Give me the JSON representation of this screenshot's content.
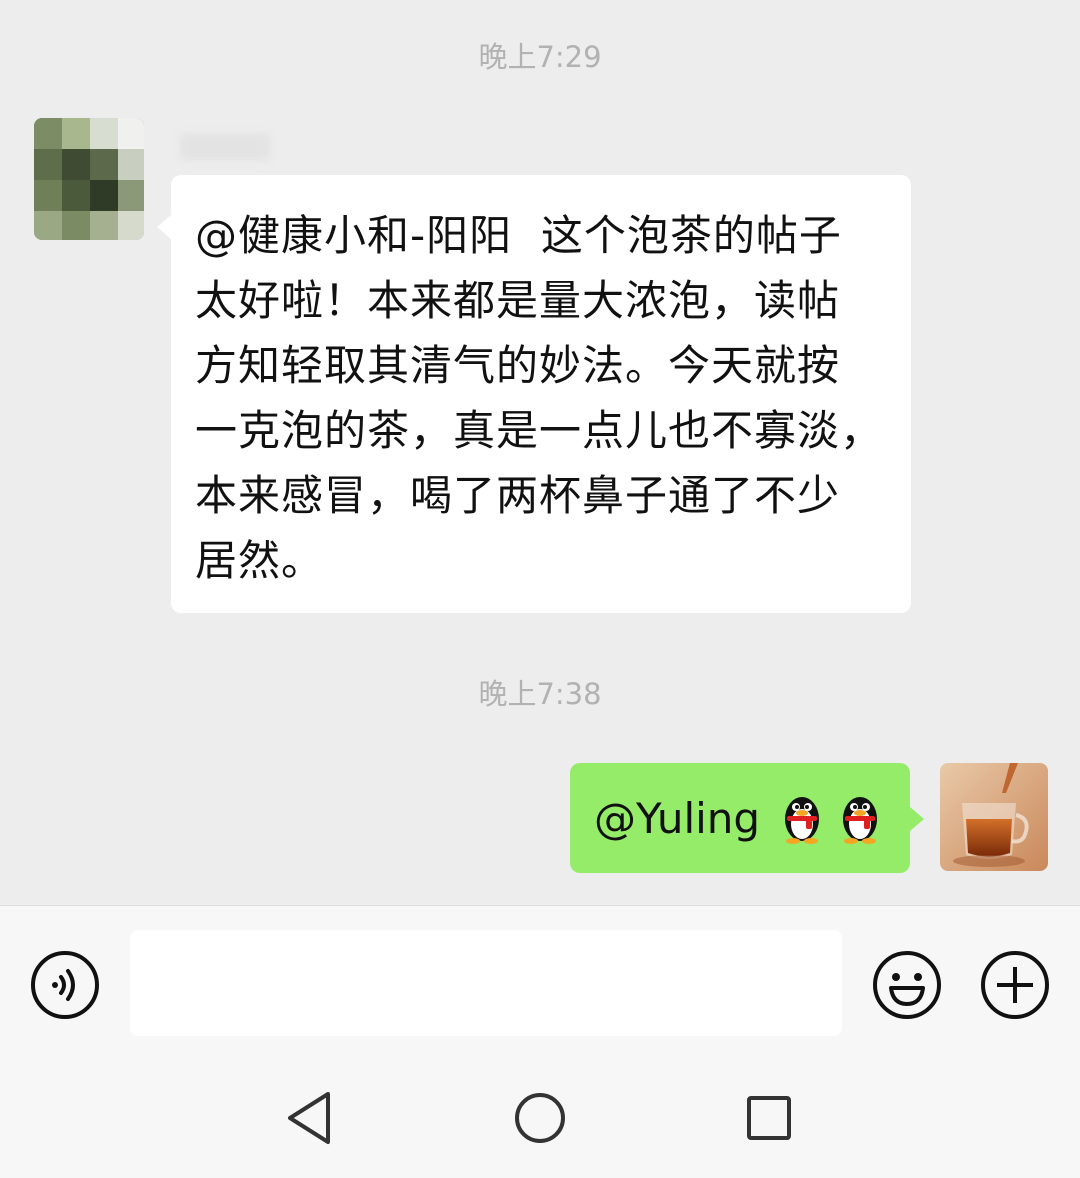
{
  "conversation": {
    "timestamps": [
      "晚上7:29",
      "晚上7:38"
    ],
    "messages": [
      {
        "side": "left",
        "text": "@健康小和-阳阳  这个泡茶的帖子\n太好啦！本来都是量大浓泡，读帖\n方知轻取其清气的妙法。今天就按\n一克泡的茶，真是一点儿也不寡淡，\n本来感冒，喝了两杯鼻子通了不少\n居然。",
        "bubble_color": "#ffffff"
      },
      {
        "side": "right",
        "text": "@Yuling",
        "emoji": [
          "penguin-emoji",
          "penguin-emoji"
        ],
        "bubble_color": "#95ec69"
      }
    ]
  },
  "input_bar": {
    "message_value": "",
    "icons": [
      "voice-icon",
      "smiley-icon",
      "plus-icon"
    ]
  },
  "nav_bar": {
    "icons": [
      "back-triangle-icon",
      "home-circle-icon",
      "recent-square-icon"
    ]
  },
  "colors": {
    "chat_background": "#ededed",
    "own_bubble": "#95ec69",
    "other_bubble": "#ffffff",
    "timestamp_text": "#b2b2b2"
  }
}
